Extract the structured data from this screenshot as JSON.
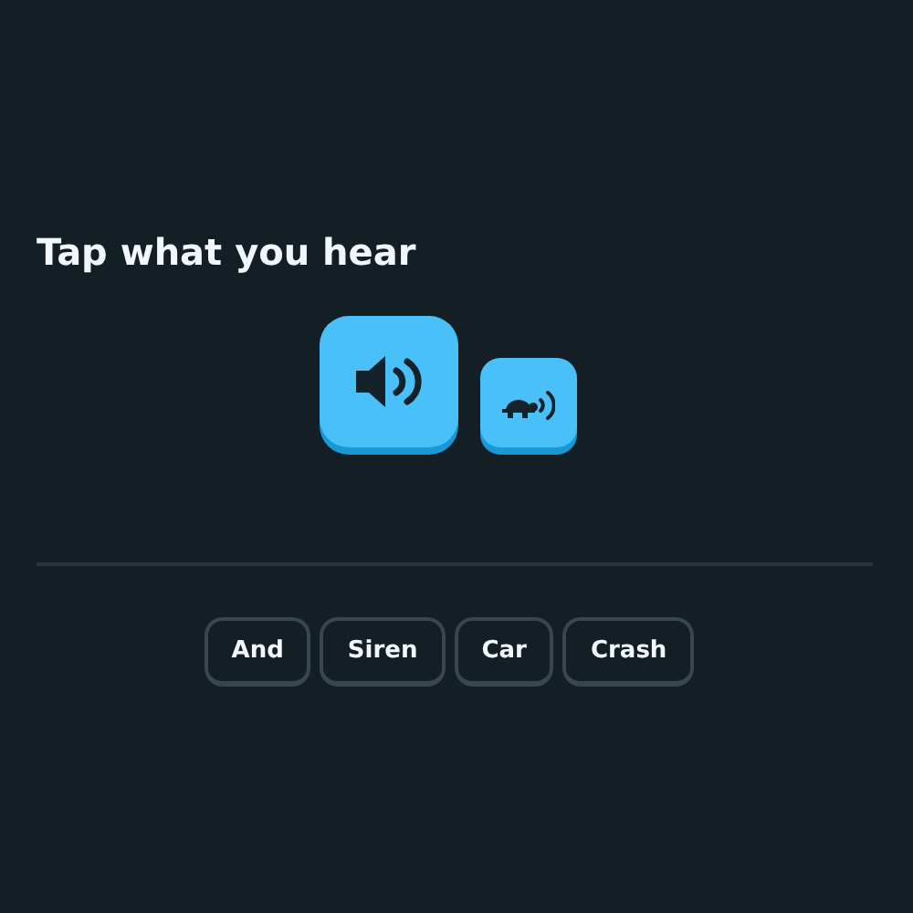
{
  "prompt": "Tap what you hear",
  "word_bank": [
    {
      "label": "And"
    },
    {
      "label": "Siren"
    },
    {
      "label": "Car"
    },
    {
      "label": "Crash"
    }
  ]
}
